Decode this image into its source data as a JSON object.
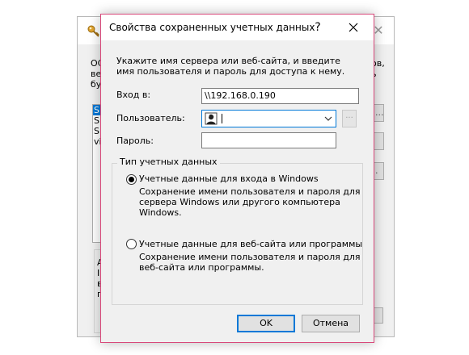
{
  "background_window": {
    "left_text": "ОС\nве\nбу",
    "right_text": "ов,\nь",
    "list_items": [
      "Sl",
      "Sl",
      "Sl",
      "vi"
    ],
    "side_button_label": "...",
    "group_left_text": "А\nI\nв\nп"
  },
  "dialog": {
    "title": "Свойства сохраненных учетных данных",
    "help_symbol": "?",
    "intro": "Укажите имя сервера или веб-сайта, и введите имя пользователя и пароль для доступа к нему.",
    "login_label": "Вход в:",
    "login_value": "\\\\192.168.0.190",
    "user_label": "Пользователь:",
    "user_value": "",
    "browse_label": "...",
    "password_label": "Пароль:",
    "password_value": "",
    "group_title": "Тип учетных данных",
    "option_windows": {
      "title": "Учетные данные для входа в Windows",
      "description": "Сохранение имени пользователя и пароля для сервера Windows или другого компьютера Windows.",
      "selected": true
    },
    "option_web": {
      "title": "Учетные данные для веб-сайта или программы",
      "description": "Сохранение имени пользователя и пароля для веб-сайта или программы.",
      "selected": false
    },
    "ok_label": "OK",
    "cancel_label": "Отмена"
  },
  "colors": {
    "accent": "#0078d7",
    "dialog_border": "#d8487a",
    "window_bg": "#f0f0f0"
  },
  "icons": [
    "key-icon",
    "close-icon",
    "user-icon",
    "chevron-down-icon"
  ]
}
